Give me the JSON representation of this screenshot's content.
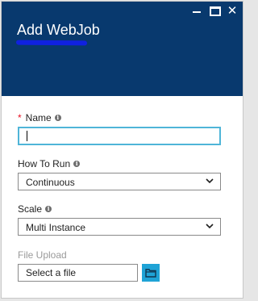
{
  "blade": {
    "title": "Add WebJob",
    "subtitle": "",
    "window_controls": [
      "minimize-icon",
      "maximize-icon",
      "close-icon"
    ],
    "close_glyph": "✕",
    "header_color": "#08396e"
  },
  "form": {
    "name": {
      "label": "Name",
      "required_marker": "*",
      "value": ""
    },
    "how_to_run": {
      "label": "How To Run",
      "selected": "Continuous"
    },
    "scale": {
      "label": "Scale",
      "selected": "Multi Instance"
    },
    "file_upload": {
      "label": "File Upload",
      "placeholder": "Select a file",
      "browse_icon": "folder-icon",
      "accent_color": "#1fa3d6"
    },
    "info_glyph": "i"
  }
}
